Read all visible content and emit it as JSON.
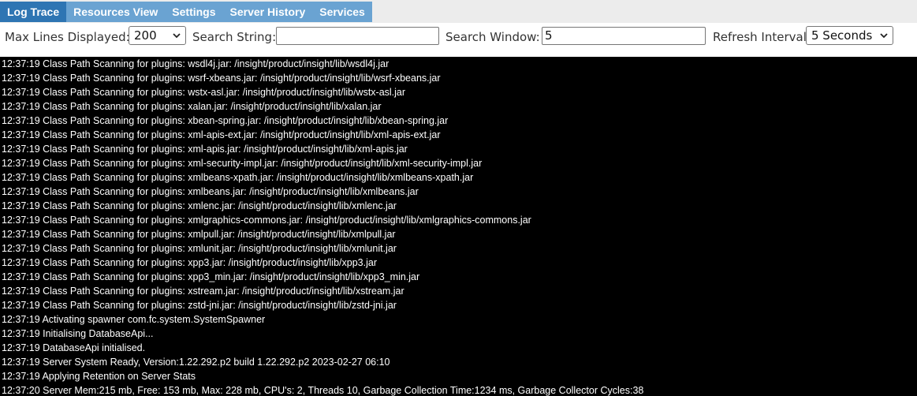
{
  "tabs": [
    {
      "label": "Log Trace",
      "active": true
    },
    {
      "label": "Resources View",
      "active": false
    },
    {
      "label": "Settings",
      "active": false
    },
    {
      "label": "Server History",
      "active": false
    },
    {
      "label": "Services",
      "active": false
    }
  ],
  "controls": {
    "max_lines_label": "Max Lines Displayed:",
    "max_lines_value": "200",
    "search_string_label": "Search String:",
    "search_string_value": "",
    "search_window_label": "Search Window:",
    "search_window_value": "5",
    "refresh_interval_label": "Refresh Interval",
    "refresh_interval_value": "5 Seconds"
  },
  "log": {
    "lines": [
      "12:37:19 Class Path Scanning for plugins: wsdl4j.jar: /insight/product/insight/lib/wsdl4j.jar",
      "12:37:19 Class Path Scanning for plugins: wsrf-xbeans.jar: /insight/product/insight/lib/wsrf-xbeans.jar",
      "12:37:19 Class Path Scanning for plugins: wstx-asl.jar: /insight/product/insight/lib/wstx-asl.jar",
      "12:37:19 Class Path Scanning for plugins: xalan.jar: /insight/product/insight/lib/xalan.jar",
      "12:37:19 Class Path Scanning for plugins: xbean-spring.jar: /insight/product/insight/lib/xbean-spring.jar",
      "12:37:19 Class Path Scanning for plugins: xml-apis-ext.jar: /insight/product/insight/lib/xml-apis-ext.jar",
      "12:37:19 Class Path Scanning for plugins: xml-apis.jar: /insight/product/insight/lib/xml-apis.jar",
      "12:37:19 Class Path Scanning for plugins: xml-security-impl.jar: /insight/product/insight/lib/xml-security-impl.jar",
      "12:37:19 Class Path Scanning for plugins: xmlbeans-xpath.jar: /insight/product/insight/lib/xmlbeans-xpath.jar",
      "12:37:19 Class Path Scanning for plugins: xmlbeans.jar: /insight/product/insight/lib/xmlbeans.jar",
      "12:37:19 Class Path Scanning for plugins: xmlenc.jar: /insight/product/insight/lib/xmlenc.jar",
      "12:37:19 Class Path Scanning for plugins: xmlgraphics-commons.jar: /insight/product/insight/lib/xmlgraphics-commons.jar",
      "12:37:19 Class Path Scanning for plugins: xmlpull.jar: /insight/product/insight/lib/xmlpull.jar",
      "12:37:19 Class Path Scanning for plugins: xmlunit.jar: /insight/product/insight/lib/xmlunit.jar",
      "12:37:19 Class Path Scanning for plugins: xpp3.jar: /insight/product/insight/lib/xpp3.jar",
      "12:37:19 Class Path Scanning for plugins: xpp3_min.jar: /insight/product/insight/lib/xpp3_min.jar",
      "12:37:19 Class Path Scanning for plugins: xstream.jar: /insight/product/insight/lib/xstream.jar",
      "12:37:19 Class Path Scanning for plugins: zstd-jni.jar: /insight/product/insight/lib/zstd-jni.jar",
      "12:37:19 Activating spawner com.fc.system.SystemSpawner",
      "12:37:19 Initialising DatabaseApi...",
      "12:37:19 DatabaseApi initialised.",
      "12:37:19 Server System Ready, Version:1.22.292.p2 build 1.22.292.p2 2023-02-27 06:10",
      "12:37:19 Applying Retention on Server Stats",
      "12:37:20 Server Mem:215 mb, Free: 153 mb, Max: 228 mb, CPU's: 2, Threads 10, Garbage Collection Time:1234 ms, Garbage Collector Cycles:38"
    ]
  }
}
